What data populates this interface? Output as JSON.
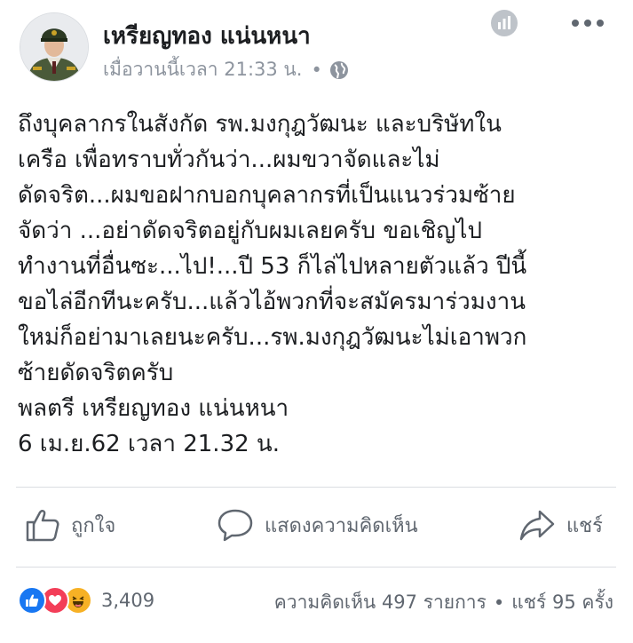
{
  "header": {
    "author": "เหรียญทอง แน่นหนา",
    "timestamp": "เมื่อวานนี้เวลา 21:33 น.",
    "separator": "•",
    "privacy_icon": "globe-icon",
    "insights_icon": "stats-icon",
    "menu_icon": "more-options-icon"
  },
  "post": {
    "lines": [
      "ถึงบุคลากรในสังกัด รพ.มงกุฎวัฒนะ และบริษัทใน",
      "เครือ เพื่อทราบทั่วกันว่า...ผมขวาจัดและไม่",
      "ดัดจริต...ผมขอฝากบอกบุคลากรที่เป็นแนวร่วมซ้าย",
      "จัดว่า ...อย่าดัดจริตอยู่กับผมเลยครับ ขอเชิญไป",
      "ทำงานที่อื่นซะ...ไป!...ปี 53 ก็ไล่ไปหลายตัวแล้ว ปีนี้",
      "ขอไล่อีกทีนะครับ...แล้วไอ้พวกที่จะสมัครมาร่วมงาน",
      "ใหม่ก็อย่ามาเลยนะครับ...รพ.มงกุฎวัฒนะไม่เอาพวก",
      "ซ้ายดัดจริตครับ",
      "พลตรี เหรียญทอง แน่นหนา",
      "6 เม.ย.62 เวลา 21.32 น."
    ]
  },
  "actions": {
    "like_label": "ถูกใจ",
    "comment_label": "แสดงความคิดเห็น",
    "share_label": "แชร์"
  },
  "footer": {
    "reaction_icons": [
      "like-reaction-icon",
      "love-reaction-icon",
      "haha-reaction-icon"
    ],
    "reaction_count": "3,409",
    "comments": "ความคิดเห็น 497 รายการ",
    "separator": "•",
    "shares": "แชร์ 95 ครั้ง"
  },
  "colors": {
    "text": "#1c1e21",
    "secondary": "#606770",
    "meta": "#8d949e",
    "like": "#1877f2",
    "love": "#f33e58",
    "haha": "#f7b125"
  }
}
